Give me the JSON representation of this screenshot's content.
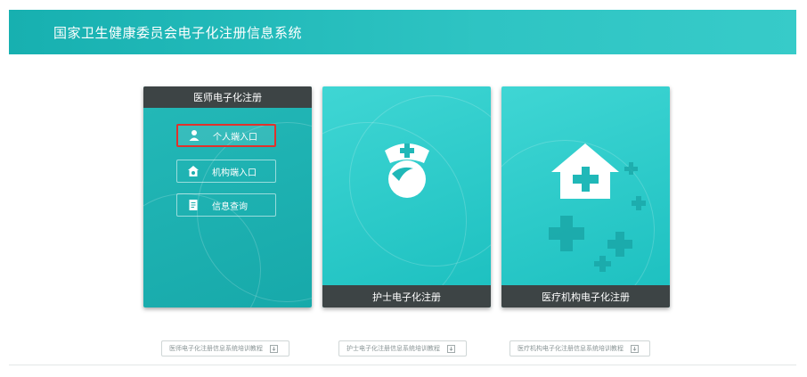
{
  "header": {
    "title": "国家卫生健康委员会电子化注册信息系统"
  },
  "cards": {
    "doctor": {
      "title": "医师电子化注册",
      "entries": [
        {
          "label": "个人端入口",
          "icon": "person-icon",
          "selected": true
        },
        {
          "label": "机构端入口",
          "icon": "house-icon",
          "selected": false
        },
        {
          "label": "信息查询",
          "icon": "document-icon",
          "selected": false
        }
      ]
    },
    "nurse": {
      "title": "护士电子化注册",
      "icon": "nurse-cap-icon"
    },
    "institution": {
      "title": "医疗机构电子化注册",
      "icon": "hospital-house-icon"
    }
  },
  "guides": [
    {
      "label": "医师电子化注册信息系统培训教程",
      "icon": "download-icon"
    },
    {
      "label": "护士电子化注册信息系统培训教程",
      "icon": "download-icon"
    },
    {
      "label": "医疗机构电子化注册信息系统培训教程",
      "icon": "download-icon"
    }
  ],
  "colors": {
    "brand_teal": "#1fb4b4",
    "card_header": "#3d4445",
    "selected_border": "#e0322c"
  }
}
